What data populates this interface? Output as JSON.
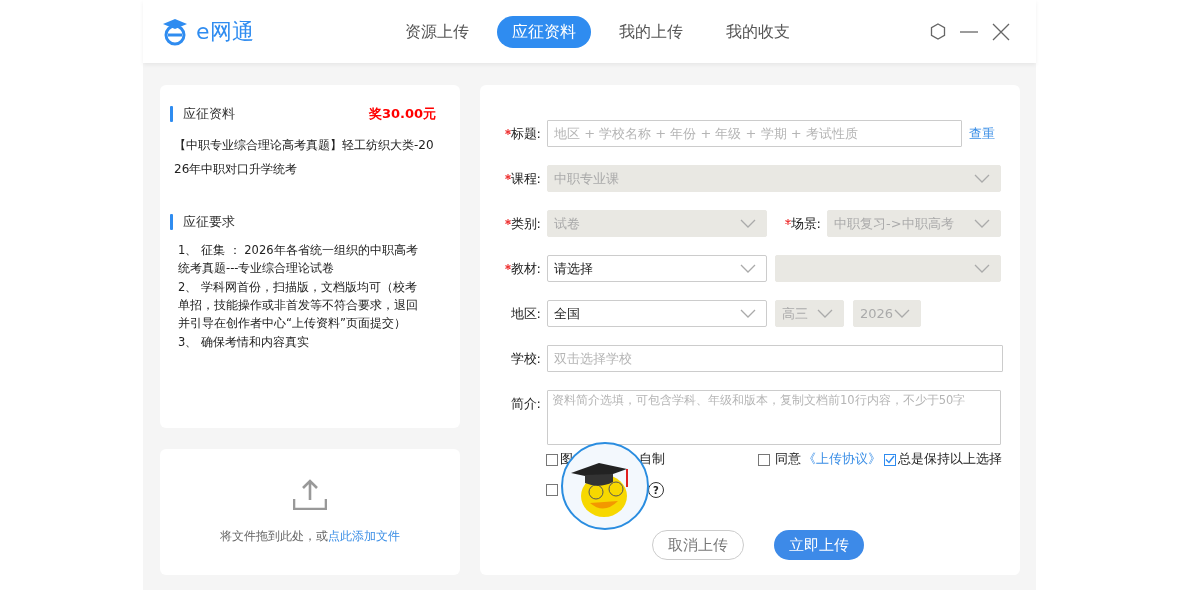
{
  "header": {
    "logo": "e网通",
    "tabs": [
      {
        "label": "资源上传",
        "selected": false
      },
      {
        "label": "应征资料",
        "selected": true
      },
      {
        "label": "我的上传",
        "selected": false
      },
      {
        "label": "我的收支",
        "selected": false
      }
    ]
  },
  "call_card": {
    "title": "应征资料",
    "reward": "奖30.00元",
    "description": "【中职专业综合理论高考真题】轻工纺织大类-2026年中职对口升学统考",
    "requirements_title": "应征要求",
    "requirements": [
      "1、 征集 ： 2026年各省统一组织的中职高考统考真题---专业综合理论试卷",
      "2、 学科网首份，扫描版，文档版均可（校考单招，技能操作或非首发等不符合要求，退回并引导在创作者中心“上传资料”页面提交）",
      "3、 确保考情和内容真实"
    ]
  },
  "upload": {
    "text": "将文件拖到此处，或",
    "link": "点此添加文件"
  },
  "form": {
    "rows": [
      {
        "kind": "title",
        "label": "标题:",
        "required": true,
        "placeholder": "地区 + 学校名称 + 年份 + 年级 + 学期 + 考试性质",
        "action": "查重"
      },
      {
        "kind": "select",
        "label": "课程:",
        "required": true,
        "selects": [
          {
            "value": "中职专业课",
            "disabled": true
          }
        ]
      },
      {
        "kind": "two-selects",
        "label": "类别:",
        "required": true,
        "selects": [
          {
            "value": "试卷",
            "disabled": true
          },
          {
            "label": "场景:",
            "required": true,
            "value": "中职复习->中职高考",
            "disabled": true
          }
        ]
      },
      {
        "kind": "two-selects",
        "label": "教材:",
        "required": true,
        "selects": [
          {
            "value": "请选择",
            "disabled": false
          },
          {
            "disabled": true
          }
        ]
      },
      {
        "kind": "region",
        "label": "地区:",
        "required": false,
        "selects": [
          {
            "value": "全国",
            "disabled": false
          },
          {
            "value": "高三",
            "disabled": true
          },
          {
            "value": "2026",
            "disabled": true
          }
        ]
      },
      {
        "kind": "text",
        "label": "学校:",
        "required": false,
        "placeholder": "双击选择学校"
      },
      {
        "kind": "textarea",
        "label": "简介:",
        "required": false,
        "placeholder": "资料简介选填，可包含学科、年级和版本，复制文档前10行内容，不少于50字"
      }
    ],
    "options": [
      {
        "checked": false,
        "label_start": "图",
        "label_end": "自制"
      },
      {
        "checked": false,
        "help": "?"
      }
    ],
    "agree": {
      "checked": false,
      "text": "同意",
      "link": "《上传协议》"
    },
    "keep": {
      "checked": true,
      "label": "总是保持以上选择"
    },
    "cancel": "取消上传",
    "submit": "立即上传"
  }
}
